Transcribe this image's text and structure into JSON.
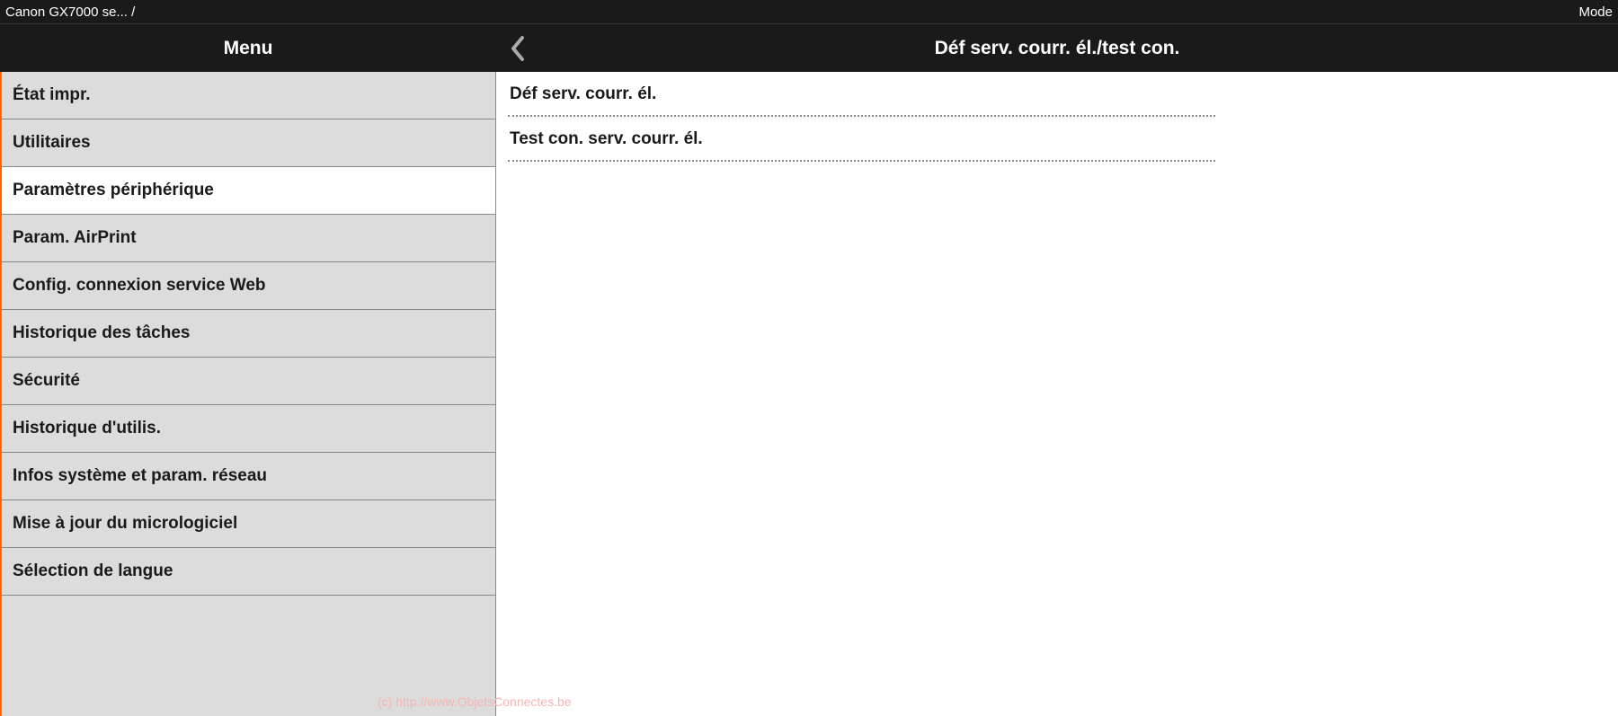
{
  "topbar": {
    "breadcrumb": "Canon GX7000 se... /",
    "right": "Mode"
  },
  "header": {
    "menu_label": "Menu",
    "content_title": "Déf serv. courr. él./test con."
  },
  "sidebar": {
    "items": [
      {
        "label": "État impr.",
        "selected": false
      },
      {
        "label": "Utilitaires",
        "selected": false
      },
      {
        "label": "Paramètres périphérique",
        "selected": true
      },
      {
        "label": "Param. AirPrint",
        "selected": false
      },
      {
        "label": "Config. connexion service Web",
        "selected": false
      },
      {
        "label": "Historique des tâches",
        "selected": false
      },
      {
        "label": "Sécurité",
        "selected": false
      },
      {
        "label": "Historique d'utilis.",
        "selected": false
      },
      {
        "label": "Infos système et param. réseau",
        "selected": false
      },
      {
        "label": "Mise à jour du micrologiciel",
        "selected": false
      },
      {
        "label": "Sélection de langue",
        "selected": false
      }
    ]
  },
  "content": {
    "items": [
      {
        "label": "Déf serv. courr. él."
      },
      {
        "label": "Test con. serv. courr. él."
      }
    ]
  },
  "watermark": "(c) http://www.ObjetsConnectes.be"
}
